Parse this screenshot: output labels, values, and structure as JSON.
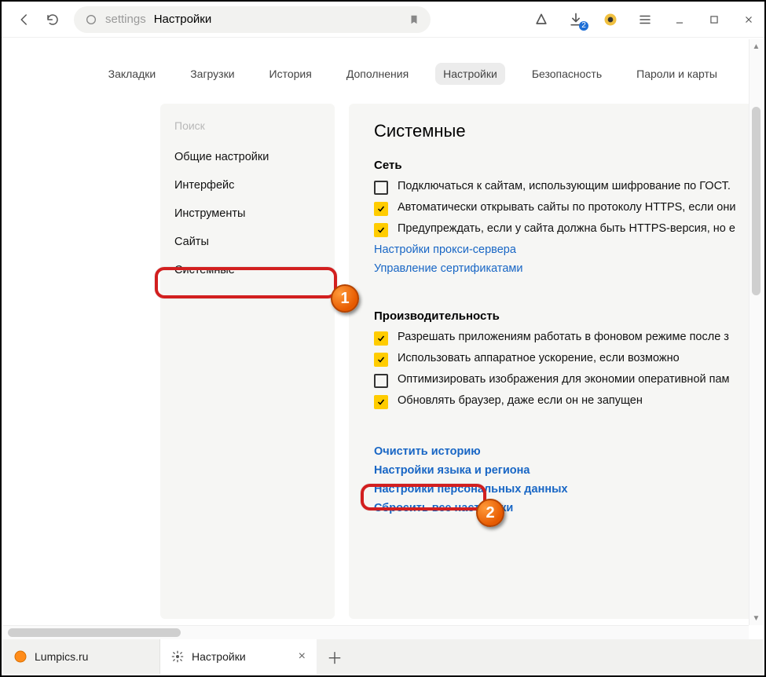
{
  "colors": {
    "accent": "#ffcc00",
    "link": "#1866c5",
    "callout": "#d21f1f"
  },
  "toolbar": {
    "omnibox_scheme": "settings",
    "omnibox_title": "Настройки",
    "download_badge": "2"
  },
  "top_nav": [
    {
      "label": "Закладки",
      "active": false
    },
    {
      "label": "Загрузки",
      "active": false
    },
    {
      "label": "История",
      "active": false
    },
    {
      "label": "Дополнения",
      "active": false
    },
    {
      "label": "Настройки",
      "active": true
    },
    {
      "label": "Безопасность",
      "active": false
    },
    {
      "label": "Пароли и карты",
      "active": false
    }
  ],
  "sidebar": {
    "search_placeholder": "Поиск",
    "items": [
      {
        "label": "Общие настройки",
        "selected": false
      },
      {
        "label": "Интерфейс",
        "selected": false
      },
      {
        "label": "Инструменты",
        "selected": false
      },
      {
        "label": "Сайты",
        "selected": false
      },
      {
        "label": "Системные",
        "selected": true
      }
    ]
  },
  "main": {
    "title": "Системные",
    "section_network": {
      "title": "Сеть",
      "checkboxes": [
        {
          "checked": false,
          "label": "Подключаться к сайтам, использующим шифрование по ГОСТ."
        },
        {
          "checked": true,
          "label": "Автоматически открывать сайты по протоколу HTTPS, если они"
        },
        {
          "checked": true,
          "label": "Предупреждать, если у сайта должна быть HTTPS-версия, но е"
        }
      ],
      "links": [
        "Настройки прокси-сервера",
        "Управление сертификатами"
      ]
    },
    "section_perf": {
      "title": "Производительность",
      "checkboxes": [
        {
          "checked": true,
          "label": "Разрешать приложениям работать в фоновом режиме после з"
        },
        {
          "checked": true,
          "label": "Использовать аппаратное ускорение, если возможно"
        },
        {
          "checked": false,
          "label": "Оптимизировать изображения для экономии оперативной пам"
        },
        {
          "checked": true,
          "label": "Обновлять браузер, даже если он не запущен"
        }
      ]
    },
    "bottom_links": [
      "Очистить историю",
      "Настройки языка и региона",
      "Настройки персональных данных",
      "Сбросить все настройки"
    ]
  },
  "annotations": {
    "badge1": "1",
    "badge2": "2"
  },
  "tabs": [
    {
      "label": "Lumpics.ru",
      "active": false,
      "favicon": "orange-circle-icon"
    },
    {
      "label": "Настройки",
      "active": true,
      "favicon": "gear-icon"
    }
  ]
}
